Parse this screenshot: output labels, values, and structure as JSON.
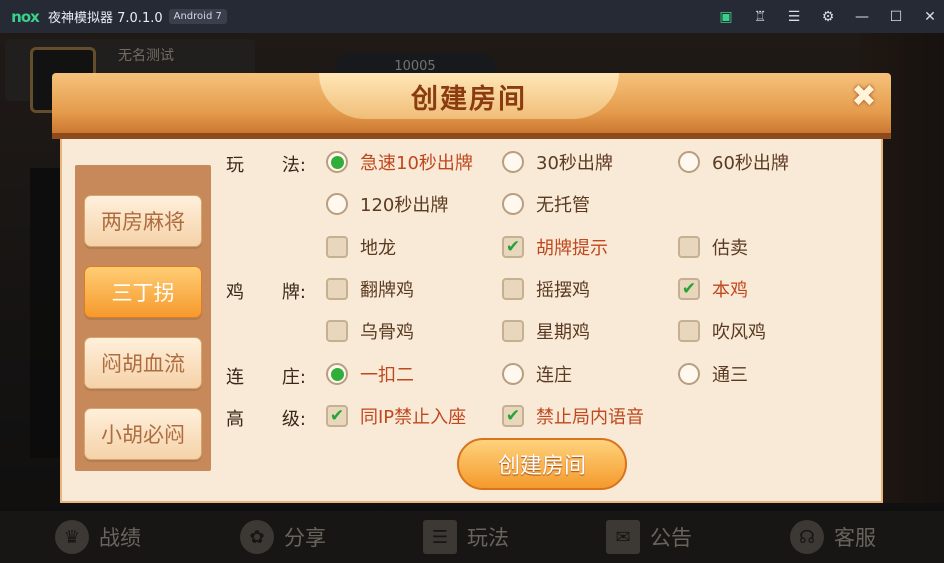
{
  "titlebar": {
    "logo": "nox",
    "title": "夜神模拟器 7.0.1.0",
    "badge": "Android 7",
    "icons": [
      "store-icon",
      "shirt-icon",
      "menu-icon",
      "settings-icon",
      "minimize-icon",
      "maximize-icon",
      "close-window-icon"
    ]
  },
  "background": {
    "player_name": "无名测试",
    "coins": "10005"
  },
  "dialog": {
    "title": "创建房间",
    "modes": [
      "两房麻将",
      "三丁拐",
      "闷胡血流",
      "小胡必闷"
    ],
    "active_mode": "三丁拐",
    "rows": {
      "play": {
        "label": "玩 法:"
      },
      "chicken": {
        "label": "鸡 牌:"
      },
      "banker": {
        "label": "连 庄:"
      },
      "advanced": {
        "label": "高 级:"
      }
    },
    "options": {
      "fast10": "急速10秒出牌",
      "s30": "30秒出牌",
      "s60": "60秒出牌",
      "s120": "120秒出牌",
      "no_auto": "无托管",
      "dilong": "地龙",
      "hint": "胡牌提示",
      "gumai": "估卖",
      "fanpai": "翻牌鸡",
      "yaobai": "摇摆鸡",
      "benji": "本鸡",
      "wugu": "乌骨鸡",
      "xingqi": "星期鸡",
      "chuifeng": "吹风鸡",
      "yikouer": "一扣二",
      "lianzhuang": "连庄",
      "tongsan": "通三",
      "same_ip": "同IP禁止入座",
      "no_voice": "禁止局内语音"
    },
    "create_button": "创建房间"
  },
  "bottom_nav": [
    "战绩",
    "分享",
    "玩法",
    "公告",
    "客服"
  ]
}
